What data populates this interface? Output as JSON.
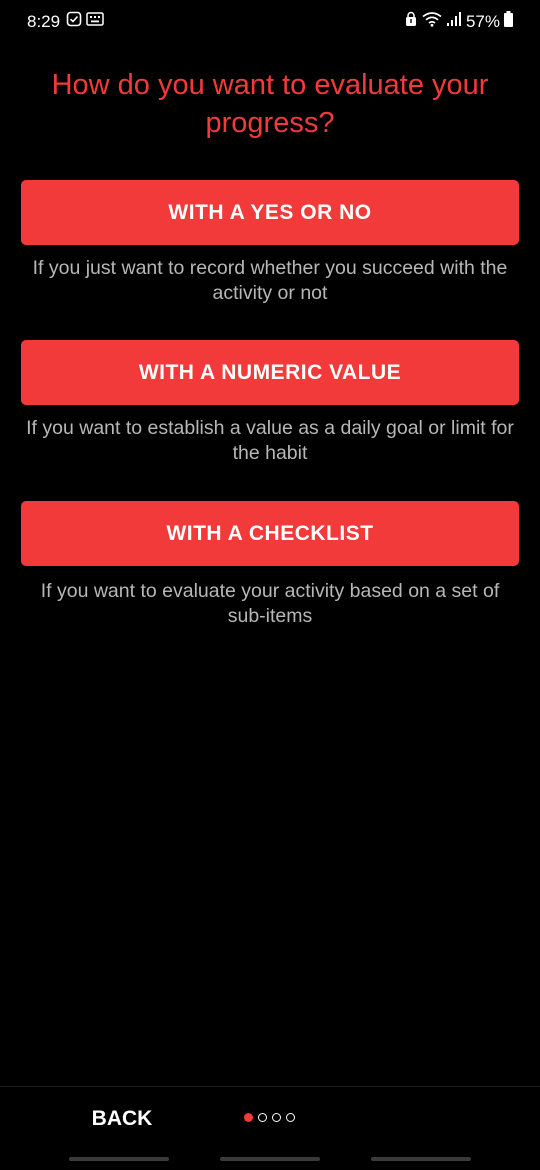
{
  "status_bar": {
    "time": "8:29",
    "battery": "57%",
    "left_icons": [
      "check-badge-icon",
      "keyboard-icon"
    ],
    "right_icons": [
      "lock-alert-icon",
      "wifi-icon",
      "signal-icon",
      "battery-icon"
    ]
  },
  "title": "How do you want to evaluate your progress?",
  "options": [
    {
      "label": "WITH A YES OR NO",
      "description": "If you just want to record whether you succeed with the activity or not"
    },
    {
      "label": "WITH A NUMERIC VALUE",
      "description": "If you want to establish a value as a daily goal or limit for the habit"
    },
    {
      "label": "WITH A CHECKLIST",
      "description": "If you want to evaluate your activity based on a set of sub-items"
    }
  ],
  "footer": {
    "back_label": "BACK",
    "pager": {
      "current_page": 1,
      "total_pages": 4
    }
  },
  "colors": {
    "accent": "#f23a3a",
    "background": "#000000",
    "description_text": "#b7b7b7",
    "button_text": "#ffffff"
  }
}
